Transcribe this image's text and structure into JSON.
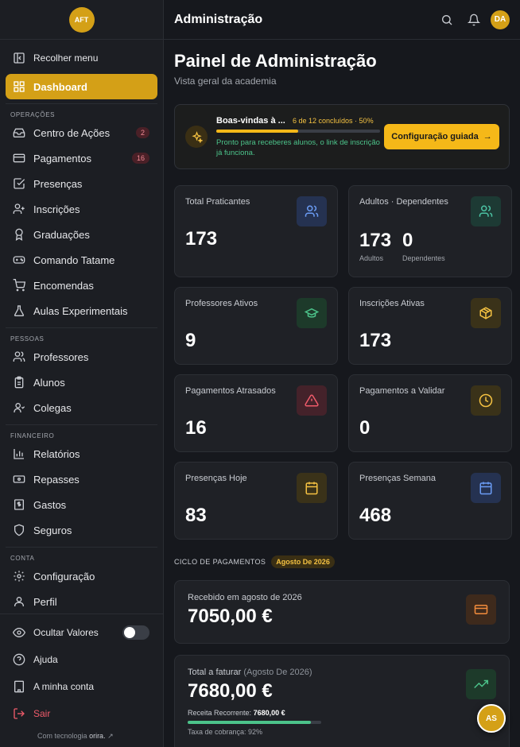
{
  "sidebar": {
    "logo": "AFT",
    "collapse": "Recolher menu",
    "dashboard": "Dashboard",
    "sections": {
      "operacoes": "OPERAÇÕES",
      "pessoas": "PESSOAS",
      "financeiro": "FINANCEIRO",
      "conta": "CONTA"
    },
    "operacoes": [
      {
        "label": "Centro de Ações",
        "icon": "inbox-icon",
        "badge": "2"
      },
      {
        "label": "Pagamentos",
        "icon": "credit-card-icon",
        "badge": "16"
      },
      {
        "label": "Presenças",
        "icon": "check-square-icon"
      },
      {
        "label": "Inscrições",
        "icon": "user-plus-icon"
      },
      {
        "label": "Graduações",
        "icon": "award-icon"
      },
      {
        "label": "Comando Tatame",
        "icon": "gamepad-icon"
      },
      {
        "label": "Encomendas",
        "icon": "cart-icon"
      },
      {
        "label": "Aulas Experimentais",
        "icon": "flask-icon"
      }
    ],
    "pessoas": [
      {
        "label": "Professores",
        "icon": "users-icon"
      },
      {
        "label": "Alunos",
        "icon": "clipboard-icon"
      },
      {
        "label": "Colegas",
        "icon": "contact-icon"
      }
    ],
    "financeiro": [
      {
        "label": "Relatórios",
        "icon": "bar-chart-icon"
      },
      {
        "label": "Repasses",
        "icon": "banknote-icon"
      },
      {
        "label": "Gastos",
        "icon": "receipt-icon"
      },
      {
        "label": "Seguros",
        "icon": "shield-icon"
      }
    ],
    "conta": [
      {
        "label": "Configuração",
        "icon": "gear-icon"
      },
      {
        "label": "Perfil",
        "icon": "user-icon"
      }
    ],
    "bottom": {
      "hide_values": "Ocultar Valores",
      "help": "Ajuda",
      "my_account": "A minha conta",
      "logout": "Sair",
      "powered_prefix": "Com tecnologia",
      "powered_brand": "orira."
    }
  },
  "header": {
    "title": "Administração",
    "avatar": "DA"
  },
  "page": {
    "title": "Painel de Administração",
    "subtitle": "Vista geral da academia"
  },
  "welcome": {
    "title": "Boas-vindas à ...",
    "progress_text": "6 de 12 concluídos · 50%",
    "progress": 0.5,
    "message": "Pronto para receberes alunos, o link de inscrição já funciona.",
    "button": "Configuração guiada"
  },
  "stats": {
    "total": {
      "label": "Total Praticantes",
      "value": "173"
    },
    "adults": {
      "label": "Adultos · Dependentes",
      "adults": "173",
      "adults_sub": "Adultos",
      "dependents": "0",
      "dependents_sub": "Dependentes"
    },
    "teachers": {
      "label": "Professores Ativos",
      "value": "9"
    },
    "enrollments": {
      "label": "Inscrições Ativas",
      "value": "173"
    },
    "late": {
      "label": "Pagamentos Atrasados",
      "value": "16"
    },
    "validate": {
      "label": "Pagamentos a Validar",
      "value": "0"
    },
    "today": {
      "label": "Presenças Hoje",
      "value": "83"
    },
    "week": {
      "label": "Presenças Semana",
      "value": "468"
    }
  },
  "cycle": {
    "label": "CICLO DE PAGAMENTOS",
    "period": "Agosto De 2026",
    "received_label": "Recebido em agosto de 2026",
    "received_value": "7050,00 €",
    "billing_label": "Total a faturar",
    "billing_period": "(Agosto De 2026)",
    "billing_value": "7680,00 €",
    "recurring_label": "Receita Recorrente:",
    "recurring_value": "7680,00 €",
    "collection_rate_text": "Taxa de cobrança: 92%",
    "collection_rate": 0.92
  },
  "fab": "AS",
  "colors": {
    "accent": "#d4a017",
    "yellow": "#f5b818",
    "green": "#4cc38a",
    "red": "#ef5b6a"
  }
}
